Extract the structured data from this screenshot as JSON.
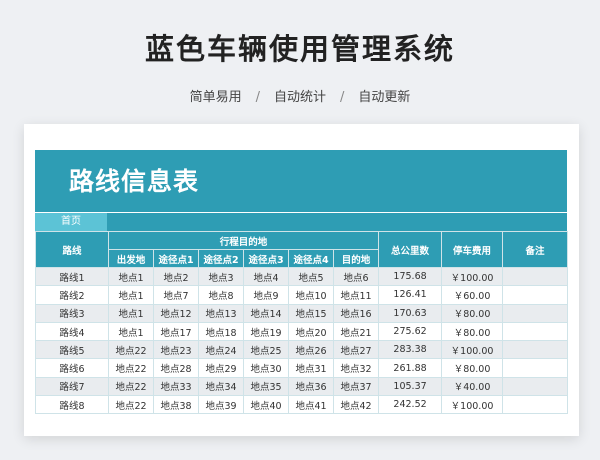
{
  "header": {
    "title": "蓝色车辆使用管理系统",
    "features": [
      "简单易用",
      "自动统计",
      "自动更新"
    ],
    "separator": "/"
  },
  "sheet": {
    "title": "路线信息表",
    "home_tab": "首页",
    "columns": {
      "route": "路线",
      "itinerary": "行程目的地",
      "origin": "出发地",
      "waypoint1": "途径点1",
      "waypoint2": "途径点2",
      "waypoint3": "途径点3",
      "waypoint4": "途径点4",
      "destination": "目的地",
      "total_km": "总公里数",
      "parking_fee": "停车费用",
      "remarks": "备注"
    },
    "rows": [
      [
        "路线1",
        "地点1",
        "地点2",
        "地点3",
        "地点4",
        "地点5",
        "地点6",
        "175.68",
        "￥100.00",
        ""
      ],
      [
        "路线2",
        "地点1",
        "地点7",
        "地点8",
        "地点9",
        "地点10",
        "地点11",
        "126.41",
        "￥60.00",
        ""
      ],
      [
        "路线3",
        "地点1",
        "地点12",
        "地点13",
        "地点14",
        "地点15",
        "地点16",
        "170.63",
        "￥80.00",
        ""
      ],
      [
        "路线4",
        "地点1",
        "地点17",
        "地点18",
        "地点19",
        "地点20",
        "地点21",
        "275.62",
        "￥80.00",
        ""
      ],
      [
        "路线5",
        "地点22",
        "地点23",
        "地点24",
        "地点25",
        "地点26",
        "地点27",
        "283.38",
        "￥100.00",
        ""
      ],
      [
        "路线6",
        "地点22",
        "地点28",
        "地点29",
        "地点30",
        "地点31",
        "地点32",
        "261.88",
        "￥80.00",
        ""
      ],
      [
        "路线7",
        "地点22",
        "地点33",
        "地点34",
        "地点35",
        "地点36",
        "地点37",
        "105.37",
        "￥40.00",
        ""
      ],
      [
        "路线8",
        "地点22",
        "地点38",
        "地点39",
        "地点40",
        "地点41",
        "地点42",
        "242.52",
        "￥100.00",
        ""
      ]
    ]
  }
}
